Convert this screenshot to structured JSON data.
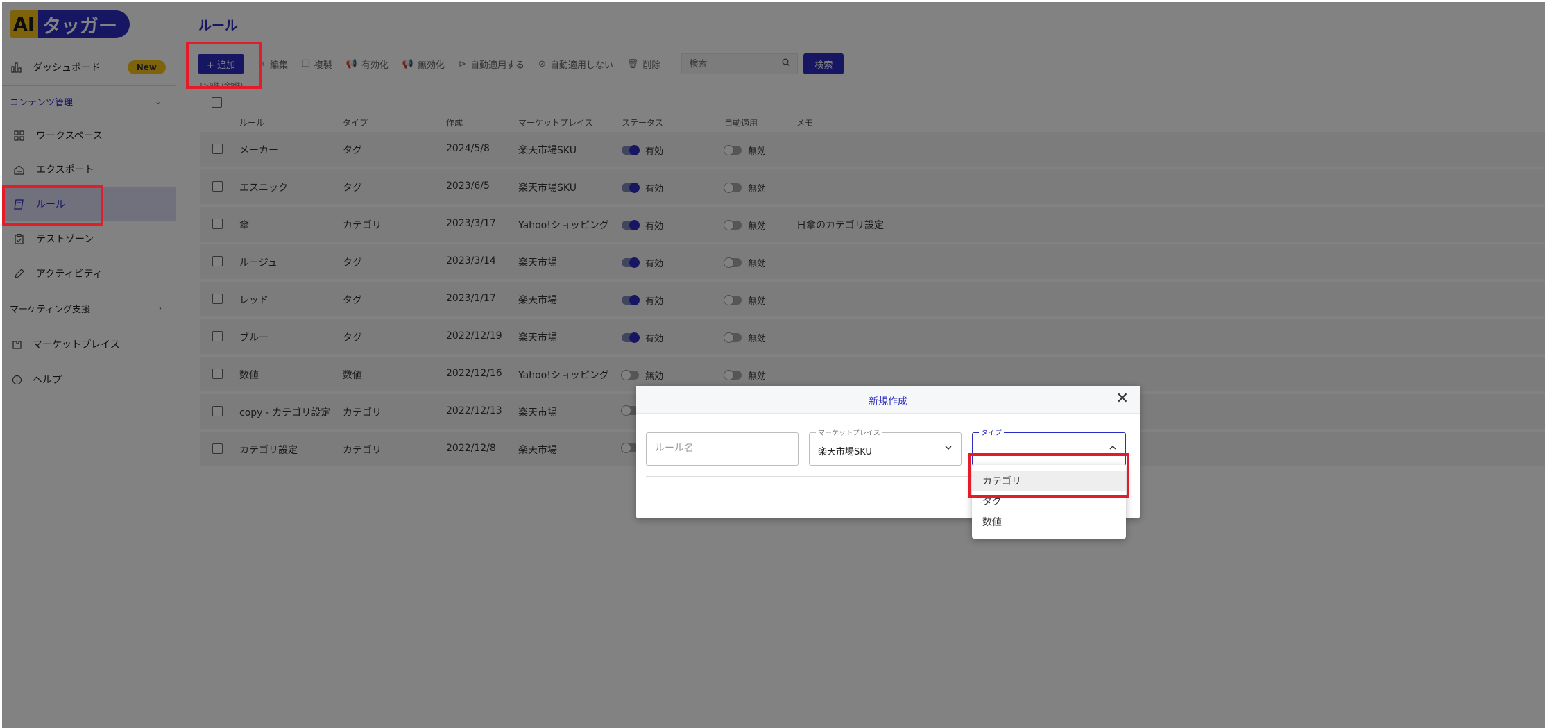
{
  "brand": {
    "ai": "AI",
    "name": "タッガー"
  },
  "sidebar": {
    "dashboard": {
      "label": "ダッシュボード",
      "badge": "New"
    },
    "content_section": "コンテンツ管理",
    "items": [
      {
        "label": "ワークスペース",
        "icon": "grid-icon"
      },
      {
        "label": "エクスポート",
        "icon": "export-icon"
      },
      {
        "label": "ルール",
        "icon": "rule-icon"
      },
      {
        "label": "テストゾーン",
        "icon": "clipboard-icon"
      },
      {
        "label": "アクティビティ",
        "icon": "pencil-icon"
      }
    ],
    "marketing_section": "マーケティング支援",
    "marketplace": "マーケットプレイス",
    "help": "ヘルプ"
  },
  "page": {
    "title": "ルール"
  },
  "toolbar": {
    "add": "+ 追加",
    "edit": "編集",
    "copy": "複製",
    "enable": "有効化",
    "disable": "無効化",
    "auto_apply": "自動適用する",
    "no_auto_apply": "自動適用しない",
    "delete": "削除",
    "search_placeholder": "検索",
    "search_button": "検索",
    "count_text": "1〜9件 (全9件)"
  },
  "table": {
    "headers": [
      "ルール",
      "タイプ",
      "作成",
      "マーケットプレイス",
      "ステータス",
      "自動適用",
      "メモ"
    ],
    "rows": [
      {
        "rule": "メーカー",
        "type": "タグ",
        "created": "2024/5/8",
        "marketplace": "楽天市場SKU",
        "status": "有効",
        "status_on": true,
        "auto": "無効",
        "auto_on": false,
        "memo": ""
      },
      {
        "rule": "エスニック",
        "type": "タグ",
        "created": "2023/6/5",
        "marketplace": "楽天市場SKU",
        "status": "有効",
        "status_on": true,
        "auto": "無効",
        "auto_on": false,
        "memo": ""
      },
      {
        "rule": "傘",
        "type": "カテゴリ",
        "created": "2023/3/17",
        "marketplace": "Yahoo!ショッピング",
        "status": "有効",
        "status_on": true,
        "auto": "無効",
        "auto_on": false,
        "memo": "日傘のカテゴリ設定"
      },
      {
        "rule": "ルージュ",
        "type": "タグ",
        "created": "2023/3/14",
        "marketplace": "楽天市場",
        "status": "有効",
        "status_on": true,
        "auto": "無効",
        "auto_on": false,
        "memo": ""
      },
      {
        "rule": "レッド",
        "type": "タグ",
        "created": "2023/1/17",
        "marketplace": "楽天市場",
        "status": "有効",
        "status_on": true,
        "auto": "無効",
        "auto_on": false,
        "memo": ""
      },
      {
        "rule": "ブルー",
        "type": "タグ",
        "created": "2022/12/19",
        "marketplace": "楽天市場",
        "status": "有効",
        "status_on": true,
        "auto": "無効",
        "auto_on": false,
        "memo": ""
      },
      {
        "rule": "数値",
        "type": "数値",
        "created": "2022/12/16",
        "marketplace": "Yahoo!ショッピング",
        "status": "無効",
        "status_on": false,
        "auto": "無効",
        "auto_on": false,
        "memo": ""
      },
      {
        "rule": "copy - カテゴリ設定",
        "type": "カテゴリ",
        "created": "2022/12/13",
        "marketplace": "楽天市場",
        "status": "",
        "status_on": false,
        "auto": "",
        "auto_on": false,
        "memo": ""
      },
      {
        "rule": "カテゴリ設定",
        "type": "カテゴリ",
        "created": "2022/12/8",
        "marketplace": "楽天市場",
        "status": "",
        "status_on": false,
        "auto": "",
        "auto_on": false,
        "memo": ""
      }
    ]
  },
  "modal": {
    "title": "新規作成",
    "rule_name_placeholder": "ルール名",
    "marketplace_label": "マーケットプレイス",
    "marketplace_value": "楽天市場SKU",
    "type_label": "タイプ",
    "type_options": [
      "カテゴリ",
      "タグ",
      "数値"
    ]
  },
  "colors": {
    "accent": "#2b2cc2",
    "brand_yellow": "#f5c518",
    "annotation_red": "#e41c2a"
  }
}
